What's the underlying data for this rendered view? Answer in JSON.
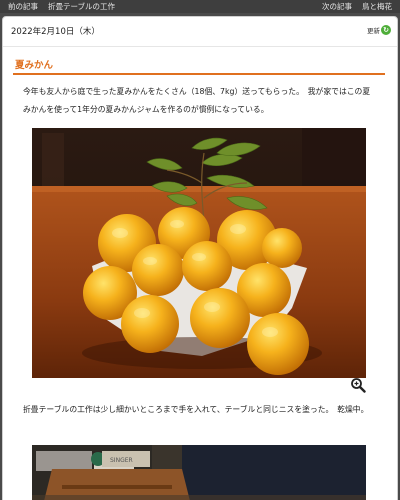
{
  "nav": {
    "prev_label": "前の記事",
    "prev_title": "折畳テーブルの工作",
    "next_label": "次の記事",
    "next_title": "鳥と梅花"
  },
  "post": {
    "date": "2022年2月10日（木）",
    "update_label": "更新",
    "update_icon": "refresh-icon",
    "title": "夏みかん",
    "paragraph1": "今年も友人から庭で生った夏みかんをたくさん（18個、7kg）送ってもらった。　我が家ではこの夏みかんを使って1年分の夏みかんジャムを作るのが慣例になっている。",
    "paragraph2": "折畳テーブルの工作は少し細かいところまで手を入れて、テーブルと同じニスを塗った。　乾燥中。",
    "photo2_label": "SINGER"
  },
  "colors": {
    "accent": "#e0701f",
    "update_badge": "#4fae3a",
    "nav_bg": "#3e3e3e"
  }
}
